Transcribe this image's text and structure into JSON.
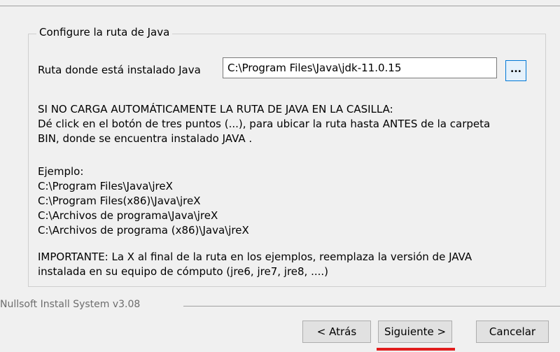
{
  "groupbox": {
    "legend": "Configure la ruta de Java"
  },
  "path": {
    "label": "Ruta donde está instalado Java",
    "value": "C:\\Program Files\\Java\\jdk-11.0.15",
    "browse_label": "..."
  },
  "instructions": {
    "line1": "SI NO CARGA AUTOMÁTICAMENTE LA RUTA DE JAVA EN LA CASILLA:",
    "line2": "Dé click en el botón de tres puntos (...), para ubicar la ruta hasta ANTES de la carpeta",
    "line3": "BIN, donde se encuentra instalado JAVA ."
  },
  "example": {
    "title": "Ejemplo:",
    "paths": [
      "C:\\Program Files\\Java\\jreX",
      "C:\\Program Files(x86)\\Java\\jreX",
      "C:\\Archivos de programa\\Java\\jreX",
      "C:\\Archivos de programa (x86)\\Java\\jreX"
    ]
  },
  "important": {
    "line1": "IMPORTANTE: La X al final de la ruta en los ejemplos, reemplaza la versión de JAVA",
    "line2": "instalada en su equipo de cómputo (jre6, jre7, jre8, ....)"
  },
  "footer": {
    "brand": "Nullsoft Install System v3.08"
  },
  "buttons": {
    "back": "< Atrás",
    "next": "Siguiente >",
    "cancel": "Cancelar"
  },
  "colors": {
    "highlight": "#e11d1d",
    "browse_border": "#0078d7"
  }
}
